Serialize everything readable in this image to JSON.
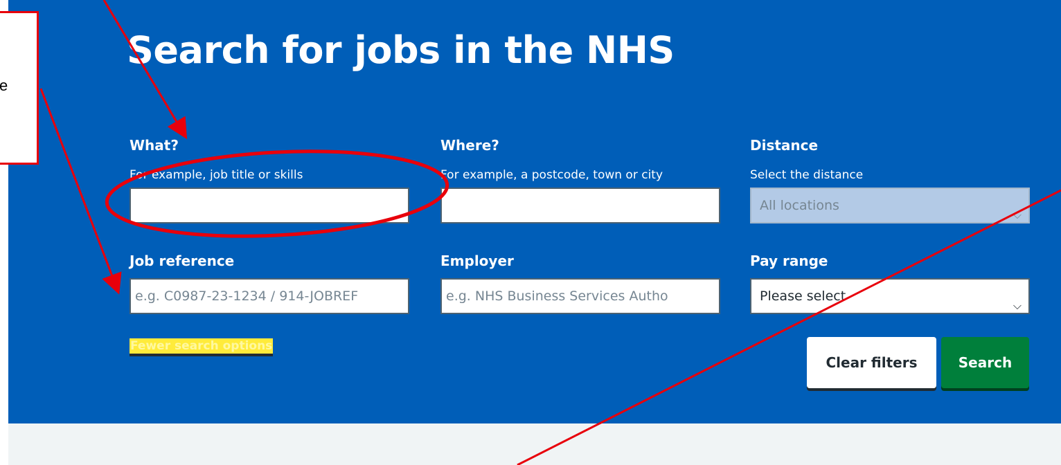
{
  "page": {
    "title": "Search for jobs in the NHS"
  },
  "search_form": {
    "what": {
      "label": "What?",
      "hint": "For example, job title or skills",
      "value": ""
    },
    "where": {
      "label": "Where?",
      "hint": "For example, a postcode, town or city",
      "value": ""
    },
    "distance": {
      "label": "Distance",
      "hint": "Select the distance",
      "selected": "All locations",
      "disabled": true
    },
    "job_reference": {
      "label": "Job reference",
      "placeholder": "e.g. C0987-23-1234 / 914-JOBREF"
    },
    "employer": {
      "label": "Employer",
      "placeholder": "e.g. NHS Business Services Autho"
    },
    "pay_range": {
      "label": "Pay range",
      "selected": "Please select"
    },
    "toggle_link": "Fewer search options",
    "clear_button": "Clear filters",
    "search_button": "Search"
  },
  "annotation": {
    "callout_text": "e",
    "color": "#e8000b"
  },
  "colors": {
    "panel_blue": "#005eb8",
    "search_green": "#007f3b",
    "link_highlight": "#ffeb3b",
    "grey_band": "#f0f4f5"
  }
}
